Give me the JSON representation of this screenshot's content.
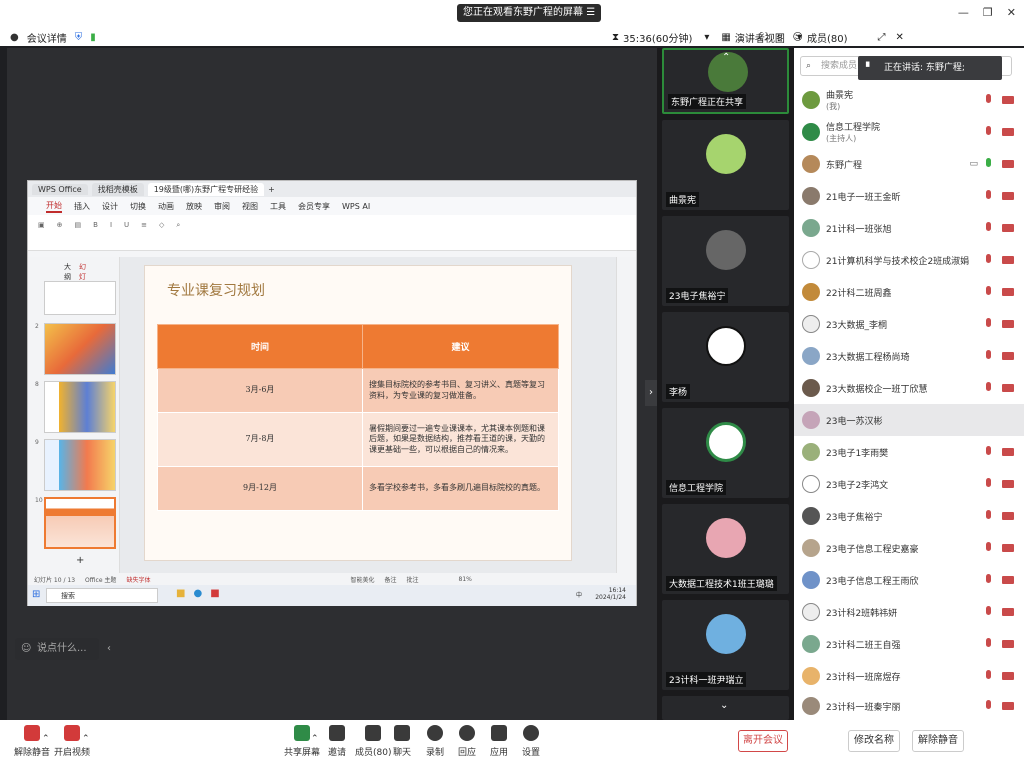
{
  "titlebar": {
    "banner": "您正在观看东野广程的屏幕",
    "banner_icon": "menu-icon"
  },
  "infobar": {
    "meeting_info": "会议详情",
    "timer": "35:36(60分钟)",
    "view": "演讲者视图",
    "members": "成员(80)"
  },
  "wps": {
    "tabs": [
      "WPS Office",
      "找稻壳模板",
      "19级暨(哪)东野广程专研经验"
    ],
    "menu": [
      "开始",
      "插入",
      "设计",
      "切换",
      "动画",
      "放映",
      "审阅",
      "视图",
      "工具",
      "会员专享",
      "WPS AI"
    ],
    "thumb_tabs": [
      "大纲",
      "幻灯片"
    ],
    "thumb_numbers": [
      "2",
      "8",
      "9",
      "10"
    ],
    "slide": {
      "title": "专业课复习规划",
      "headers": [
        "时间",
        "建议"
      ],
      "rows": [
        {
          "time": "3月-6月",
          "advice": "搜集目标院校的参考书目、复习讲义、真题等复习资料，为专业课的复习做准备。"
        },
        {
          "time": "7月-8月",
          "advice": "暑假期间要过一遍专业课课本，尤其课本例题和课后题，如果是数据结构，推荐看王道的课，天勤的课更基础一些，可以根据自己的情况来。"
        },
        {
          "time": "9月-12月",
          "advice": "多看学校参考书，多看多刷几遍目标院校的真题。"
        }
      ]
    },
    "status": [
      "幻灯片 10 / 13",
      "Office 主题",
      "缺失字体",
      "智能美化",
      "备注",
      "批注",
      "81%"
    ],
    "taskbar": {
      "search": "搜索",
      "time": "16:14",
      "date": "2024/1/24",
      "lang": "中"
    }
  },
  "chat_placeholder": "说点什么...",
  "video_tiles": [
    {
      "name": "东野广程正在共享"
    },
    {
      "name": "曲景宪"
    },
    {
      "name": "23电子焦裕宁"
    },
    {
      "name": "李杨"
    },
    {
      "name": "信息工程学院"
    },
    {
      "name": "大数据工程技术1班王璐璐"
    },
    {
      "name": "23计科一班尹瑞立"
    }
  ],
  "panel": {
    "search_placeholder": "搜索成员",
    "speaking": "正在讲话: 东野广程;",
    "participants": [
      {
        "name": "曲景宪",
        "sub": "(我)"
      },
      {
        "name": "信息工程学院",
        "sub": "(主持人)"
      },
      {
        "name": "东野广程",
        "sub": ""
      },
      {
        "name": "21电子一班王金昕",
        "sub": ""
      },
      {
        "name": "21计科一班张旭",
        "sub": ""
      },
      {
        "name": "21计算机科学与技术校企2班成淑娟",
        "sub": ""
      },
      {
        "name": "22计科二班周鑫",
        "sub": ""
      },
      {
        "name": "23大数据_李桐",
        "sub": ""
      },
      {
        "name": "23大数据工程杨尚琦",
        "sub": ""
      },
      {
        "name": "23大数据校企一班丁欣慧",
        "sub": ""
      },
      {
        "name": "23电一苏汉彬",
        "sub": ""
      },
      {
        "name": "23电子1李雨樊",
        "sub": ""
      },
      {
        "name": "23电子2李鸿文",
        "sub": ""
      },
      {
        "name": "23电子焦裕宁",
        "sub": ""
      },
      {
        "name": "23电子信息工程史嘉豪",
        "sub": ""
      },
      {
        "name": "23电子信息工程王雨欣",
        "sub": ""
      },
      {
        "name": "23计科2班韩祎妍",
        "sub": ""
      },
      {
        "name": "23计科二班王自强",
        "sub": ""
      },
      {
        "name": "23计科一班席煜存",
        "sub": ""
      },
      {
        "name": "23计科一班秦宇丽",
        "sub": ""
      }
    ]
  },
  "toolbar": {
    "unmute": "解除静音",
    "video": "开启视频",
    "share": "共享屏幕",
    "invite": "邀请",
    "members": "成员(80)",
    "chat": "聊天",
    "record": "录制",
    "replay": "回应",
    "apps": "应用",
    "settings": "设置",
    "leave": "离开会议",
    "rename": "修改名称",
    "unmute2": "解除静音"
  }
}
